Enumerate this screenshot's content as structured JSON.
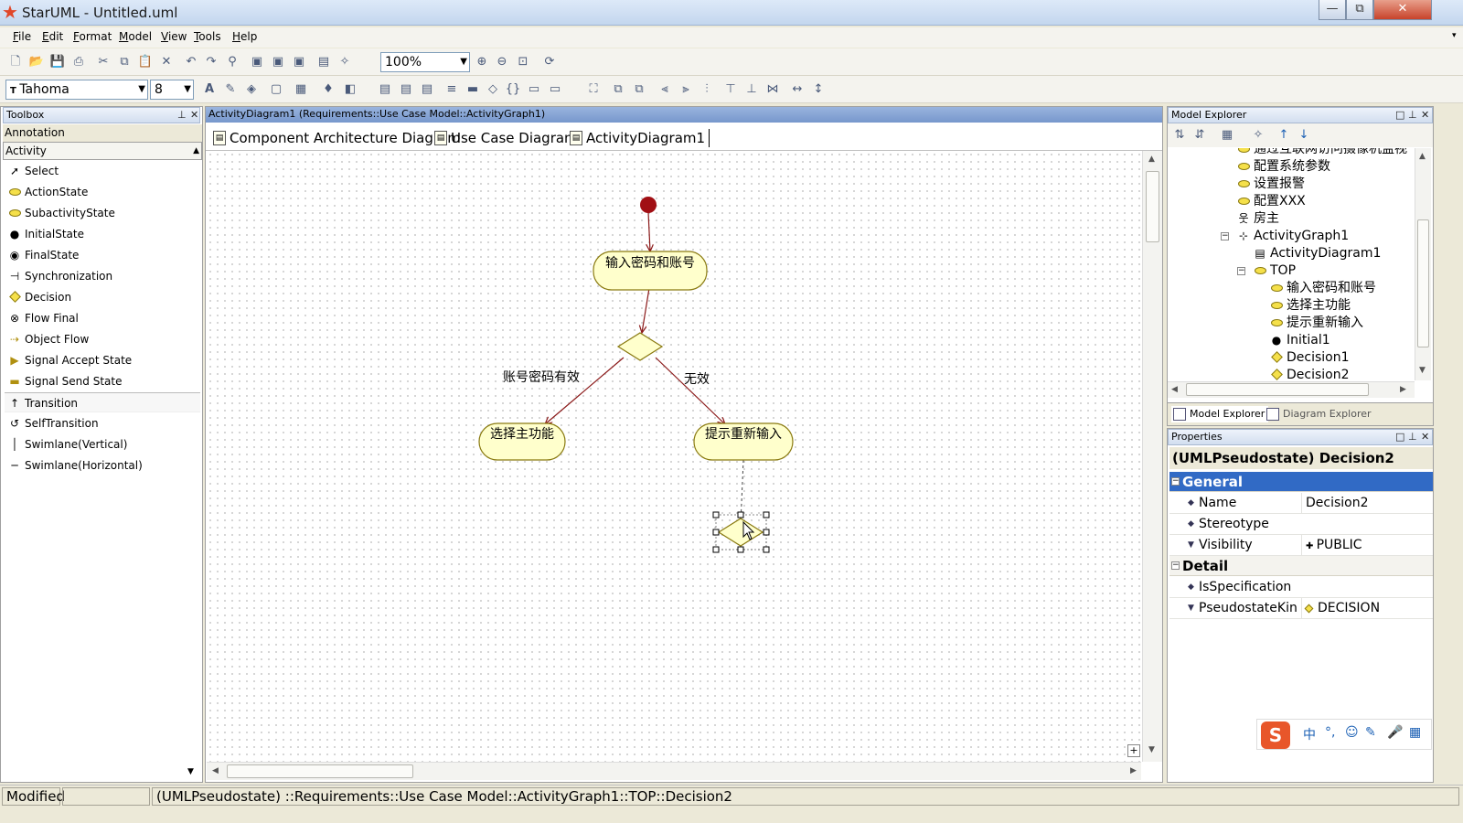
{
  "window": {
    "title": "StarUML - Untitled.uml",
    "controls": [
      "—",
      "⧉",
      "✕"
    ]
  },
  "menu": [
    "File",
    "Edit",
    "Format",
    "Model",
    "View",
    "Tools",
    "Help"
  ],
  "toolbar": {
    "zoom": "100%",
    "font": "Tahoma",
    "font_size": "8"
  },
  "toolbox": {
    "title": "Toolbox",
    "sections": [
      "Annotation",
      "Activity"
    ],
    "items": [
      {
        "label": "Select",
        "icon": "arrow-pointer-icon"
      },
      {
        "label": "ActionState",
        "icon": "action-state-icon"
      },
      {
        "label": "SubactivityState",
        "icon": "subactivity-state-icon"
      },
      {
        "label": "InitialState",
        "icon": "initial-state-icon"
      },
      {
        "label": "FinalState",
        "icon": "final-state-icon"
      },
      {
        "label": "Synchronization",
        "icon": "synchronization-icon"
      },
      {
        "label": "Decision",
        "icon": "decision-icon"
      },
      {
        "label": "Flow Final",
        "icon": "flow-final-icon"
      },
      {
        "label": "Object Flow",
        "icon": "object-flow-icon"
      },
      {
        "label": "Signal Accept State",
        "icon": "signal-accept-icon"
      },
      {
        "label": "Signal Send State",
        "icon": "signal-send-icon"
      },
      {
        "label": "Transition",
        "icon": "transition-icon"
      },
      {
        "label": "SelfTransition",
        "icon": "self-transition-icon"
      },
      {
        "label": "Swimlane(Vertical)",
        "icon": "swimlane-vertical-icon"
      },
      {
        "label": "Swimlane(Horizontal)",
        "icon": "swimlane-horizontal-icon"
      }
    ]
  },
  "editor": {
    "title": "ActivityDiagram1 (Requirements::Use Case Model::ActivityGraph1)",
    "tabs": [
      "Component Architecture Diagram",
      "Use Case Diagram",
      "ActivityDiagram1"
    ]
  },
  "diagram": {
    "nodes": {
      "action1": "输入密码和账号",
      "action2": "选择主功能",
      "action3": "提示重新输入"
    },
    "guards": {
      "valid": "账号密码有效",
      "invalid": "无效"
    }
  },
  "explorer": {
    "title": "Model Explorer",
    "tree": [
      {
        "label": "通过互联网访问摄像机监视",
        "icon": "usecase-icon"
      },
      {
        "label": "配置系统参数",
        "icon": "usecase-icon"
      },
      {
        "label": "设置报警",
        "icon": "usecase-icon"
      },
      {
        "label": "配置XXX",
        "icon": "usecase-icon"
      },
      {
        "label": "房主",
        "icon": "actor-icon"
      },
      {
        "label": "ActivityGraph1",
        "icon": "activity-graph-icon"
      },
      {
        "label": "ActivityDiagram1",
        "icon": "diagram-icon"
      },
      {
        "label": "TOP",
        "icon": "composite-state-icon"
      },
      {
        "label": "输入密码和账号",
        "icon": "action-state-icon"
      },
      {
        "label": "选择主功能",
        "icon": "action-state-icon"
      },
      {
        "label": "提示重新输入",
        "icon": "action-state-icon"
      },
      {
        "label": "Initial1",
        "icon": "initial-state-icon"
      },
      {
        "label": "Decision1",
        "icon": "decision-icon"
      },
      {
        "label": "Decision2",
        "icon": "decision-icon"
      }
    ],
    "tabs": [
      "Model Explorer",
      "Diagram Explorer"
    ]
  },
  "properties": {
    "title": "Properties",
    "header": "(UMLPseudostate) Decision2",
    "categories": [
      "General",
      "Detail"
    ],
    "general": [
      {
        "name": "Name",
        "value": "Decision2"
      },
      {
        "name": "Stereotype",
        "value": ""
      },
      {
        "name": "Visibility",
        "value": "PUBLIC"
      }
    ],
    "detail": [
      {
        "name": "IsSpecification",
        "value": ""
      },
      {
        "name": "PseudostateKin",
        "value": "DECISION"
      }
    ]
  },
  "ime": {
    "logo": "S",
    "lang": "中"
  },
  "status": {
    "state": "Modified",
    "path": "(UMLPseudostate) ::Requirements::Use Case Model::ActivityGraph1::TOP::Decision2"
  },
  "colors": {
    "node_fill": "#ffffcc",
    "initial": "#a10f14",
    "edge": "#8b1a1a",
    "selection": "#316ac5"
  }
}
